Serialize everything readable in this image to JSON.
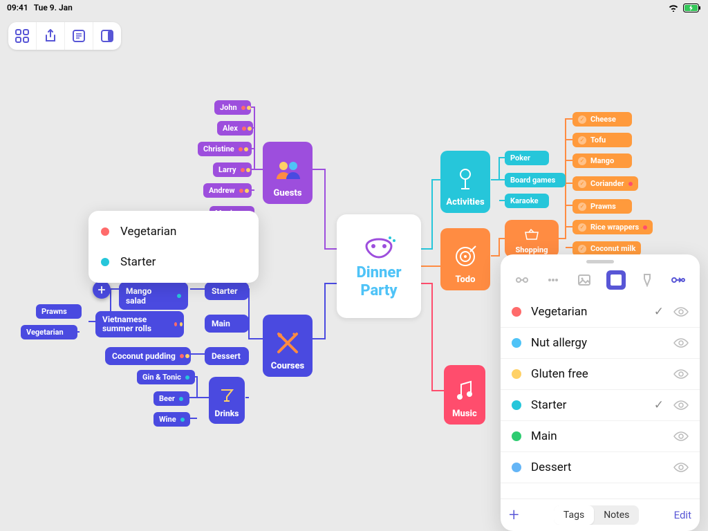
{
  "status": {
    "time": "09:41",
    "date": "Tue 9. Jan"
  },
  "toolbar": {
    "grid_tip": "grid-view",
    "share_tip": "share",
    "outline_tip": "outline",
    "panel_tip": "toggle-panel"
  },
  "center": {
    "title": "Dinner Party"
  },
  "guests": {
    "label": "Guests",
    "people": [
      "John",
      "Alex",
      "Christine",
      "Larry",
      "Andrew",
      "Monica"
    ]
  },
  "courses": {
    "label": "Courses",
    "items": {
      "starter": "Starter",
      "main": "Main",
      "dessert": "Dessert",
      "drinks": "Drinks"
    },
    "starter_children": {
      "mango_salad": "Mango salad",
      "summer_rolls": "Vietnamese summer rolls",
      "prawns": "Prawns",
      "vegetarian": "Vegetarian"
    },
    "dessert_children": {
      "coconut_pudding": "Coconut pudding"
    },
    "drinks_children": [
      "Gin & Tonic",
      "Beer",
      "Wine"
    ]
  },
  "activities": {
    "label": "Activities",
    "items": [
      "Poker",
      "Board games",
      "Karaoke"
    ]
  },
  "todo": {
    "label": "Todo",
    "shopping": "Shopping",
    "shopping_items": [
      "Cheese",
      "Tofu",
      "Mango",
      "Coriander",
      "Prawns",
      "Rice wrappers",
      "Coconut milk"
    ]
  },
  "music": {
    "label": "Music"
  },
  "tooltip": {
    "rows": [
      {
        "label": "Vegetarian",
        "color": "#ff6b6b"
      },
      {
        "label": "Starter",
        "color": "#26c6da"
      }
    ]
  },
  "panel": {
    "tabs": {
      "tags": "Tags",
      "notes": "Notes"
    },
    "edit": "Edit",
    "tags": [
      {
        "label": "Vegetarian",
        "color": "#ff6b6b",
        "checked": true
      },
      {
        "label": "Nut allergy",
        "color": "#4fc3f7",
        "checked": false
      },
      {
        "label": "Gluten free",
        "color": "#ffd166",
        "checked": false
      },
      {
        "label": "Starter",
        "color": "#26c6da",
        "checked": true
      },
      {
        "label": "Main",
        "color": "#2ecc71",
        "checked": false
      },
      {
        "label": "Dessert",
        "color": "#64b5f6",
        "checked": false
      }
    ]
  },
  "colors": {
    "purple": "#9d4edd",
    "indigo": "#4a4ae0",
    "orange": "#ff8c42",
    "teal": "#26c6da",
    "red": "#ff4d6d"
  }
}
